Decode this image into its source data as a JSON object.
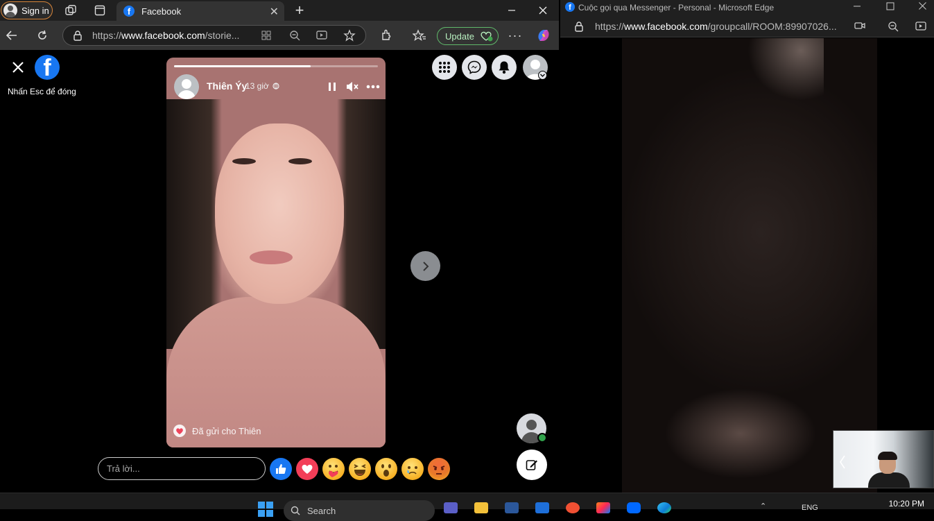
{
  "left_window": {
    "signin_label": "Sign in",
    "tab_title": "Facebook",
    "url_prefix": "https://",
    "url_domain": "www.facebook.com",
    "url_path": "/storie...",
    "update_label": "Update"
  },
  "stories": {
    "esc_hint": "Nhấn Esc để đóng",
    "author_name": "Thiên Ýy",
    "time_ago": "13 giờ",
    "progress": 0.67,
    "sent_to": "Đã gửi cho Thiên",
    "reply_placeholder": "Trả lời...",
    "reactions": [
      "like-icon",
      "love-icon",
      "care-icon",
      "haha-icon",
      "wow-icon",
      "sad-icon",
      "angry-icon"
    ]
  },
  "right_window": {
    "title": "Cuộc gọi qua Messenger - Personal - Microsoft Edge",
    "url_prefix": "https://",
    "url_domain": "www.facebook.com",
    "url_path": "/groupcall/ROOM:89907026..."
  },
  "taskbar": {
    "search_label": "Search",
    "lang": "ENG",
    "time": "10:20 PM"
  },
  "colors": {
    "facebook_blue": "#1877f2",
    "update_green": "#5fb86a",
    "online_green": "#31a24c"
  }
}
